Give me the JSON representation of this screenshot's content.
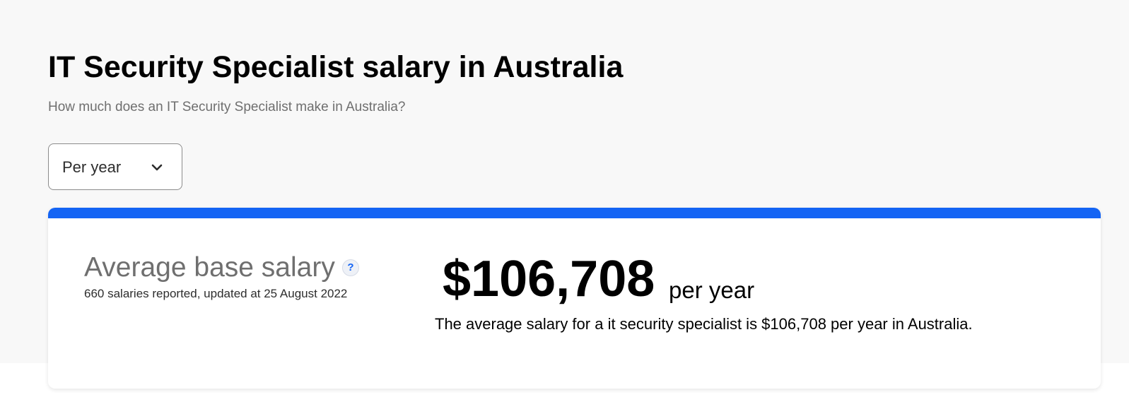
{
  "header": {
    "title": "IT Security Specialist salary in Australia",
    "subtitle": "How much does an IT Security Specialist make in Australia?"
  },
  "period_select": {
    "selected": "Per year",
    "icon": "chevron-down-icon"
  },
  "salary_card": {
    "accent_color": "#1464f4",
    "label": "Average base salary",
    "help_icon": "?",
    "reported": "660 salaries reported, updated at 25 August 2022",
    "amount": "$106,708",
    "period": "per year",
    "description": "The average salary for a it security specialist is $106,708 per year in Australia."
  }
}
